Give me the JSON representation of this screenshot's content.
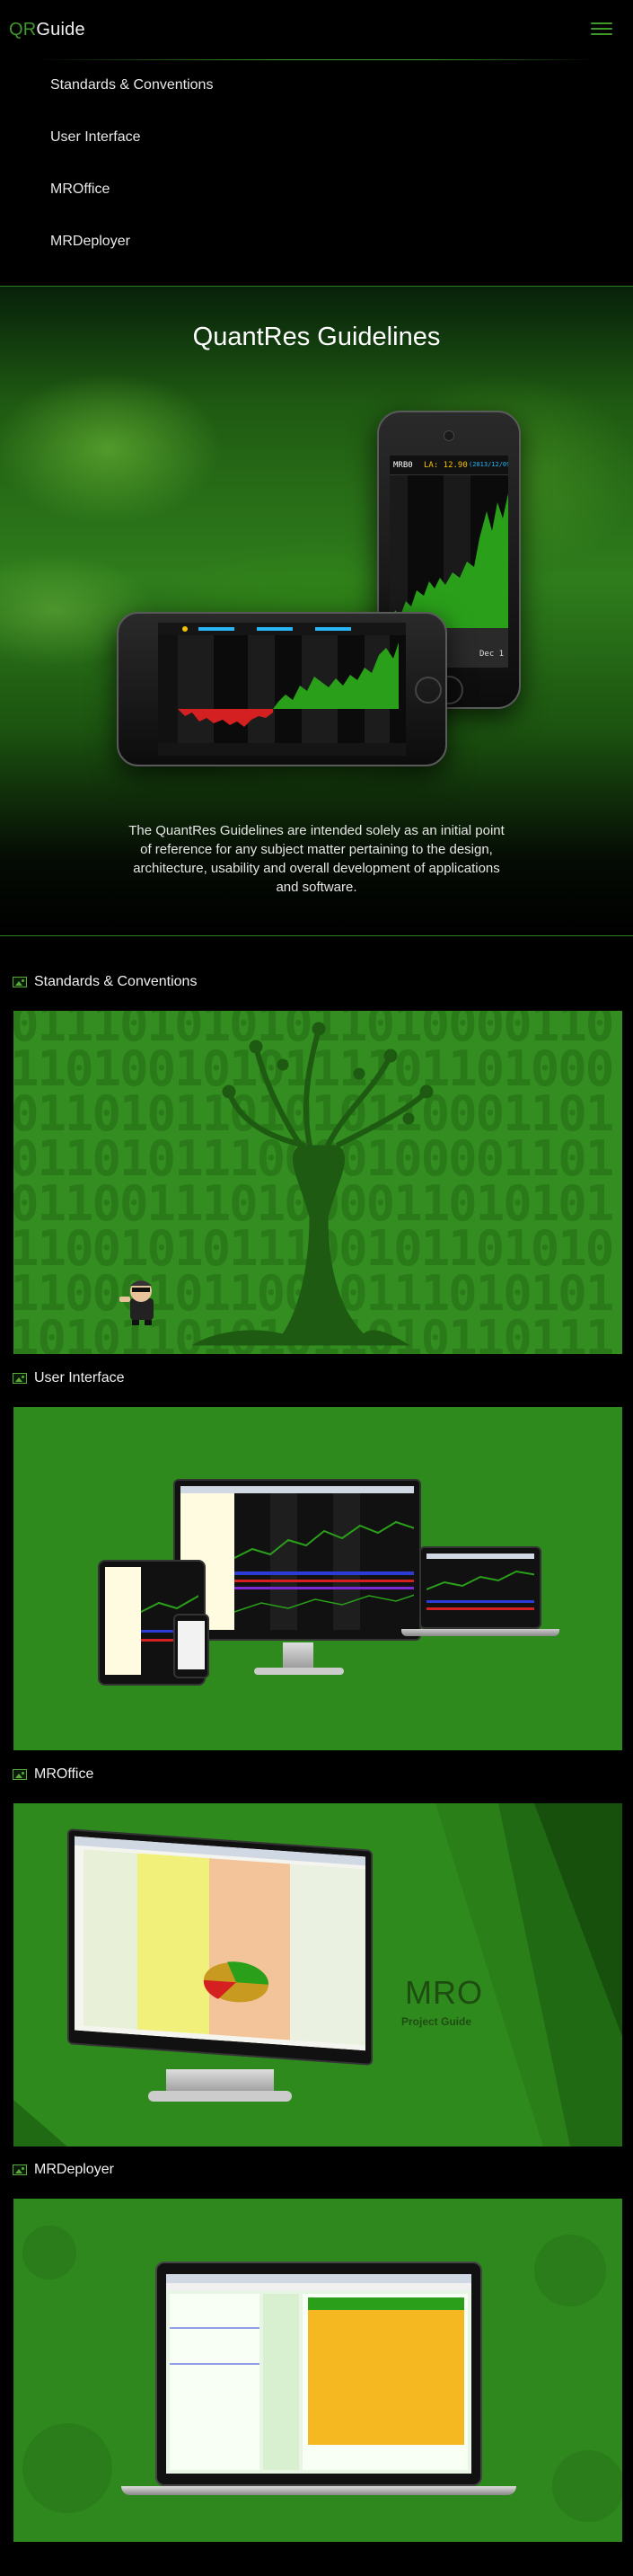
{
  "brand": {
    "prefix": "QR",
    "name": "Guide"
  },
  "nav": {
    "items": [
      "Standards & Conventions",
      "User Interface",
      "MROffice",
      "MRDeployer"
    ]
  },
  "hero": {
    "title": "QuantRes Guidelines",
    "description": "The QuantRes Guidelines are intended solely as an initial point of reference for any subject matter pertaining to the design, architecture, usability and overall development of applications and software.",
    "phone_vertical_ticker": "MRB0",
    "phone_vertical_price": "LA: 12.90",
    "phone_vertical_date": "(2013/12/09)",
    "phone_vertical_axis_label": "Dec 1"
  },
  "sections": [
    {
      "title": "Standards & Conventions",
      "image_alt": "standards-banner"
    },
    {
      "title": "User Interface",
      "image_alt": "user-interface-banner"
    },
    {
      "title": "MROffice",
      "image_alt": "mroffice-banner"
    },
    {
      "title": "MRDeployer",
      "image_alt": "mrdeployer-banner"
    }
  ],
  "mro": {
    "title": "MRO",
    "subtitle": "Project Guide"
  },
  "binary_text": "01110101010110100001101101001010111101101000011010110101011000110101101011100001000011010110011101000011010101110010101110010110101011000101100101110101011010110101011010110111011010000111001001010101101101011001011101110101100101011101010101010110011101011010",
  "colors": {
    "accent": "#3d9a2a",
    "panel_green": "#2f8a1e",
    "background": "#000000"
  }
}
